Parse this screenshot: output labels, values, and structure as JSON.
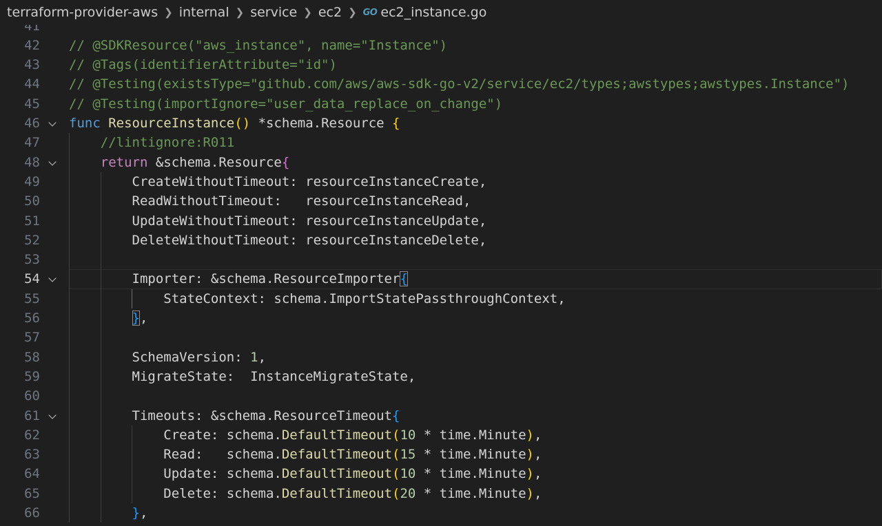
{
  "breadcrumb": {
    "items": [
      "terraform-provider-aws",
      "internal",
      "service",
      "ec2"
    ],
    "file_icon": "GO",
    "file_name": "ec2_instance.go"
  },
  "editor": {
    "language": "go",
    "active_line": 54,
    "lines": [
      {
        "num": 41,
        "tokens": []
      },
      {
        "num": 42,
        "tokens": [
          [
            "cm",
            "// @SDKResource(\"aws_instance\", name=\"Instance\")"
          ]
        ]
      },
      {
        "num": 43,
        "tokens": [
          [
            "cm",
            "// @Tags(identifierAttribute=\"id\")"
          ]
        ]
      },
      {
        "num": 44,
        "tokens": [
          [
            "cm",
            "// @Testing(existsType=\"github.com/aws/aws-sdk-go-v2/service/ec2/types;awstypes;awstypes.Instance\")"
          ]
        ]
      },
      {
        "num": 45,
        "tokens": [
          [
            "cm",
            "// @Testing(importIgnore=\"user_data_replace_on_change\")"
          ]
        ]
      },
      {
        "num": 46,
        "fold": true,
        "tokens": [
          [
            "kw",
            "func"
          ],
          [
            "",
            " "
          ],
          [
            "fn",
            "ResourceInstance"
          ],
          [
            "b1",
            "()"
          ],
          [
            "",
            " *schema.Resource "
          ],
          [
            "b1",
            "{"
          ]
        ]
      },
      {
        "num": 47,
        "tokens": [
          [
            "",
            "    "
          ],
          [
            "cm",
            "//lintignore:R011"
          ]
        ]
      },
      {
        "num": 48,
        "fold": true,
        "tokens": [
          [
            "",
            "    "
          ],
          [
            "ctrl",
            "return"
          ],
          [
            "",
            " &schema.Resource"
          ],
          [
            "b2",
            "{"
          ]
        ]
      },
      {
        "num": 49,
        "tokens": [
          [
            "",
            "        CreateWithoutTimeout: resourceInstanceCreate,"
          ]
        ]
      },
      {
        "num": 50,
        "tokens": [
          [
            "",
            "        ReadWithoutTimeout:   resourceInstanceRead,"
          ]
        ]
      },
      {
        "num": 51,
        "tokens": [
          [
            "",
            "        UpdateWithoutTimeout: resourceInstanceUpdate,"
          ]
        ]
      },
      {
        "num": 52,
        "tokens": [
          [
            "",
            "        DeleteWithoutTimeout: resourceInstanceDelete,"
          ]
        ]
      },
      {
        "num": 53,
        "tokens": []
      },
      {
        "num": 54,
        "fold": true,
        "tokens": [
          [
            "",
            "        Importer: &schema.ResourceImporter"
          ],
          [
            "b3 bm",
            "{"
          ]
        ]
      },
      {
        "num": 55,
        "tokens": [
          [
            "",
            "            StateContext: schema.ImportStatePassthroughContext,"
          ]
        ]
      },
      {
        "num": 56,
        "tokens": [
          [
            "",
            "        "
          ],
          [
            "b3 bm",
            "}"
          ],
          [
            "",
            ","
          ]
        ]
      },
      {
        "num": 57,
        "tokens": []
      },
      {
        "num": 58,
        "tokens": [
          [
            "",
            "        SchemaVersion: "
          ],
          [
            "num",
            "1"
          ],
          [
            "",
            ","
          ]
        ]
      },
      {
        "num": 59,
        "tokens": [
          [
            "",
            "        MigrateState:  InstanceMigrateState,"
          ]
        ]
      },
      {
        "num": 60,
        "tokens": []
      },
      {
        "num": 61,
        "fold": true,
        "tokens": [
          [
            "",
            "        Timeouts: &schema.ResourceTimeout"
          ],
          [
            "b3",
            "{"
          ]
        ]
      },
      {
        "num": 62,
        "tokens": [
          [
            "",
            "            Create: schema."
          ],
          [
            "fn",
            "DefaultTimeout"
          ],
          [
            "b1",
            "("
          ],
          [
            "num",
            "10"
          ],
          [
            "",
            " * time.Minute"
          ],
          [
            "b1",
            ")"
          ],
          [
            "",
            ","
          ]
        ]
      },
      {
        "num": 63,
        "tokens": [
          [
            "",
            "            Read:   schema."
          ],
          [
            "fn",
            "DefaultTimeout"
          ],
          [
            "b1",
            "("
          ],
          [
            "num",
            "15"
          ],
          [
            "",
            " * time.Minute"
          ],
          [
            "b1",
            ")"
          ],
          [
            "",
            ","
          ]
        ]
      },
      {
        "num": 64,
        "tokens": [
          [
            "",
            "            Update: schema."
          ],
          [
            "fn",
            "DefaultTimeout"
          ],
          [
            "b1",
            "("
          ],
          [
            "num",
            "10"
          ],
          [
            "",
            " * time.Minute"
          ],
          [
            "b1",
            ")"
          ],
          [
            "",
            ","
          ]
        ]
      },
      {
        "num": 65,
        "tokens": [
          [
            "",
            "            Delete: schema."
          ],
          [
            "fn",
            "DefaultTimeout"
          ],
          [
            "b1",
            "("
          ],
          [
            "num",
            "20"
          ],
          [
            "",
            " * time.Minute"
          ],
          [
            "b1",
            ")"
          ],
          [
            "",
            ","
          ]
        ]
      },
      {
        "num": 66,
        "tokens": [
          [
            "",
            "        "
          ],
          [
            "b3",
            "}"
          ],
          [
            "",
            ","
          ]
        ]
      }
    ]
  }
}
